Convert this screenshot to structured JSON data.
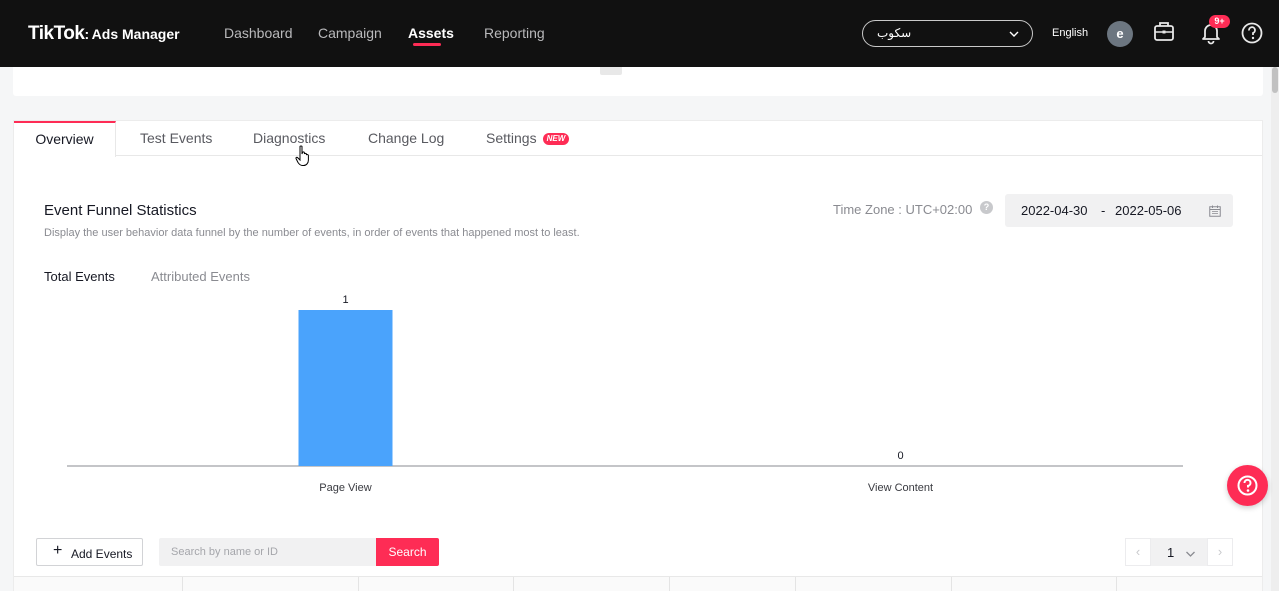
{
  "nav": {
    "logo": "TikTok",
    "logo_sub": "Ads Manager",
    "items": [
      {
        "label": "Dashboard",
        "active": false
      },
      {
        "label": "Campaign",
        "active": false
      },
      {
        "label": "Assets",
        "active": true
      },
      {
        "label": "Reporting",
        "active": false
      }
    ],
    "account_name": "سكوب",
    "language": "English",
    "avatar_initial": "e",
    "notification_badge": "9+"
  },
  "tabs": [
    {
      "label": "Overview",
      "active": true
    },
    {
      "label": "Test Events",
      "active": false
    },
    {
      "label": "Diagnostics",
      "active": false
    },
    {
      "label": "Change Log",
      "active": false
    },
    {
      "label": "Settings",
      "active": false,
      "badge": "NEW"
    }
  ],
  "section": {
    "title": "Event Funnel Statistics",
    "description": "Display the user behavior data funnel by the number of events, in order of events that happened most to least.",
    "timezone": "Time Zone : UTC+02:00",
    "date_start": "2022-04-30",
    "date_separator": "-",
    "date_end": "2022-05-06"
  },
  "subtabs": [
    {
      "label": "Total Events",
      "active": true
    },
    {
      "label": "Attributed Events",
      "active": false
    }
  ],
  "chart_data": {
    "type": "bar",
    "categories": [
      "Page View",
      "View Content"
    ],
    "values": [
      1,
      0
    ],
    "title": "",
    "xlabel": "",
    "ylabel": "",
    "ylim": [
      0,
      1
    ],
    "bar_color": "#4aa3fc",
    "grid": false
  },
  "toolbar": {
    "add_label": "Add Events",
    "search_placeholder": "Search by name or ID",
    "search_label": "Search"
  },
  "pagination": {
    "prev": "‹",
    "current": "1",
    "next": "›"
  },
  "colors": {
    "accent": "#fe2c55",
    "nav_bg": "#111111"
  }
}
